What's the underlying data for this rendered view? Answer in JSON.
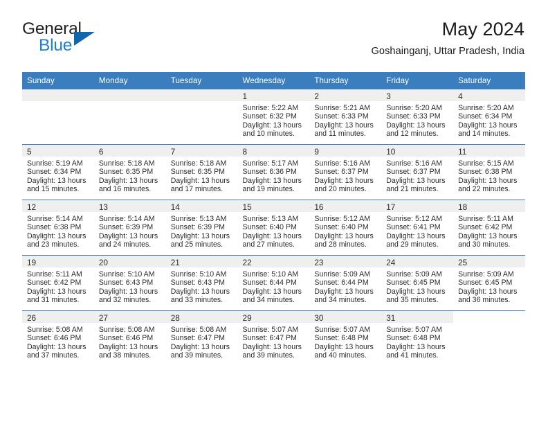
{
  "brand": {
    "word_one": "General",
    "word_two": "Blue",
    "triangle_icon": "triangle-icon"
  },
  "header": {
    "month_title": "May 2024",
    "location": "Goshainganj, Uttar Pradesh, India"
  },
  "theme": {
    "header_blue": "#3a7ec0",
    "brand_blue": "#1b7fd4",
    "band_gray": "#efefef"
  },
  "calendar": {
    "weekday_headers": [
      "Sunday",
      "Monday",
      "Tuesday",
      "Wednesday",
      "Thursday",
      "Friday",
      "Saturday"
    ],
    "weeks": [
      [
        {
          "day": "",
          "sunrise": "",
          "sunset": "",
          "daylight_1": "",
          "daylight_2": "",
          "state": "empty"
        },
        {
          "day": "",
          "sunrise": "",
          "sunset": "",
          "daylight_1": "",
          "daylight_2": "",
          "state": "empty"
        },
        {
          "day": "",
          "sunrise": "",
          "sunset": "",
          "daylight_1": "",
          "daylight_2": "",
          "state": "empty"
        },
        {
          "day": "1",
          "sunrise": "Sunrise: 5:22 AM",
          "sunset": "Sunset: 6:32 PM",
          "daylight_1": "Daylight: 13 hours",
          "daylight_2": "and 10 minutes.",
          "state": "filled"
        },
        {
          "day": "2",
          "sunrise": "Sunrise: 5:21 AM",
          "sunset": "Sunset: 6:33 PM",
          "daylight_1": "Daylight: 13 hours",
          "daylight_2": "and 11 minutes.",
          "state": "filled"
        },
        {
          "day": "3",
          "sunrise": "Sunrise: 5:20 AM",
          "sunset": "Sunset: 6:33 PM",
          "daylight_1": "Daylight: 13 hours",
          "daylight_2": "and 12 minutes.",
          "state": "filled"
        },
        {
          "day": "4",
          "sunrise": "Sunrise: 5:20 AM",
          "sunset": "Sunset: 6:34 PM",
          "daylight_1": "Daylight: 13 hours",
          "daylight_2": "and 14 minutes.",
          "state": "filled"
        }
      ],
      [
        {
          "day": "5",
          "sunrise": "Sunrise: 5:19 AM",
          "sunset": "Sunset: 6:34 PM",
          "daylight_1": "Daylight: 13 hours",
          "daylight_2": "and 15 minutes.",
          "state": "filled"
        },
        {
          "day": "6",
          "sunrise": "Sunrise: 5:18 AM",
          "sunset": "Sunset: 6:35 PM",
          "daylight_1": "Daylight: 13 hours",
          "daylight_2": "and 16 minutes.",
          "state": "filled"
        },
        {
          "day": "7",
          "sunrise": "Sunrise: 5:18 AM",
          "sunset": "Sunset: 6:35 PM",
          "daylight_1": "Daylight: 13 hours",
          "daylight_2": "and 17 minutes.",
          "state": "filled"
        },
        {
          "day": "8",
          "sunrise": "Sunrise: 5:17 AM",
          "sunset": "Sunset: 6:36 PM",
          "daylight_1": "Daylight: 13 hours",
          "daylight_2": "and 19 minutes.",
          "state": "filled"
        },
        {
          "day": "9",
          "sunrise": "Sunrise: 5:16 AM",
          "sunset": "Sunset: 6:37 PM",
          "daylight_1": "Daylight: 13 hours",
          "daylight_2": "and 20 minutes.",
          "state": "filled"
        },
        {
          "day": "10",
          "sunrise": "Sunrise: 5:16 AM",
          "sunset": "Sunset: 6:37 PM",
          "daylight_1": "Daylight: 13 hours",
          "daylight_2": "and 21 minutes.",
          "state": "filled"
        },
        {
          "day": "11",
          "sunrise": "Sunrise: 5:15 AM",
          "sunset": "Sunset: 6:38 PM",
          "daylight_1": "Daylight: 13 hours",
          "daylight_2": "and 22 minutes.",
          "state": "filled"
        }
      ],
      [
        {
          "day": "12",
          "sunrise": "Sunrise: 5:14 AM",
          "sunset": "Sunset: 6:38 PM",
          "daylight_1": "Daylight: 13 hours",
          "daylight_2": "and 23 minutes.",
          "state": "filled"
        },
        {
          "day": "13",
          "sunrise": "Sunrise: 5:14 AM",
          "sunset": "Sunset: 6:39 PM",
          "daylight_1": "Daylight: 13 hours",
          "daylight_2": "and 24 minutes.",
          "state": "filled"
        },
        {
          "day": "14",
          "sunrise": "Sunrise: 5:13 AM",
          "sunset": "Sunset: 6:39 PM",
          "daylight_1": "Daylight: 13 hours",
          "daylight_2": "and 25 minutes.",
          "state": "filled"
        },
        {
          "day": "15",
          "sunrise": "Sunrise: 5:13 AM",
          "sunset": "Sunset: 6:40 PM",
          "daylight_1": "Daylight: 13 hours",
          "daylight_2": "and 27 minutes.",
          "state": "filled"
        },
        {
          "day": "16",
          "sunrise": "Sunrise: 5:12 AM",
          "sunset": "Sunset: 6:40 PM",
          "daylight_1": "Daylight: 13 hours",
          "daylight_2": "and 28 minutes.",
          "state": "filled"
        },
        {
          "day": "17",
          "sunrise": "Sunrise: 5:12 AM",
          "sunset": "Sunset: 6:41 PM",
          "daylight_1": "Daylight: 13 hours",
          "daylight_2": "and 29 minutes.",
          "state": "filled"
        },
        {
          "day": "18",
          "sunrise": "Sunrise: 5:11 AM",
          "sunset": "Sunset: 6:42 PM",
          "daylight_1": "Daylight: 13 hours",
          "daylight_2": "and 30 minutes.",
          "state": "filled"
        }
      ],
      [
        {
          "day": "19",
          "sunrise": "Sunrise: 5:11 AM",
          "sunset": "Sunset: 6:42 PM",
          "daylight_1": "Daylight: 13 hours",
          "daylight_2": "and 31 minutes.",
          "state": "filled"
        },
        {
          "day": "20",
          "sunrise": "Sunrise: 5:10 AM",
          "sunset": "Sunset: 6:43 PM",
          "daylight_1": "Daylight: 13 hours",
          "daylight_2": "and 32 minutes.",
          "state": "filled"
        },
        {
          "day": "21",
          "sunrise": "Sunrise: 5:10 AM",
          "sunset": "Sunset: 6:43 PM",
          "daylight_1": "Daylight: 13 hours",
          "daylight_2": "and 33 minutes.",
          "state": "filled"
        },
        {
          "day": "22",
          "sunrise": "Sunrise: 5:10 AM",
          "sunset": "Sunset: 6:44 PM",
          "daylight_1": "Daylight: 13 hours",
          "daylight_2": "and 34 minutes.",
          "state": "filled"
        },
        {
          "day": "23",
          "sunrise": "Sunrise: 5:09 AM",
          "sunset": "Sunset: 6:44 PM",
          "daylight_1": "Daylight: 13 hours",
          "daylight_2": "and 34 minutes.",
          "state": "filled"
        },
        {
          "day": "24",
          "sunrise": "Sunrise: 5:09 AM",
          "sunset": "Sunset: 6:45 PM",
          "daylight_1": "Daylight: 13 hours",
          "daylight_2": "and 35 minutes.",
          "state": "filled"
        },
        {
          "day": "25",
          "sunrise": "Sunrise: 5:09 AM",
          "sunset": "Sunset: 6:45 PM",
          "daylight_1": "Daylight: 13 hours",
          "daylight_2": "and 36 minutes.",
          "state": "filled"
        }
      ],
      [
        {
          "day": "26",
          "sunrise": "Sunrise: 5:08 AM",
          "sunset": "Sunset: 6:46 PM",
          "daylight_1": "Daylight: 13 hours",
          "daylight_2": "and 37 minutes.",
          "state": "filled"
        },
        {
          "day": "27",
          "sunrise": "Sunrise: 5:08 AM",
          "sunset": "Sunset: 6:46 PM",
          "daylight_1": "Daylight: 13 hours",
          "daylight_2": "and 38 minutes.",
          "state": "filled"
        },
        {
          "day": "28",
          "sunrise": "Sunrise: 5:08 AM",
          "sunset": "Sunset: 6:47 PM",
          "daylight_1": "Daylight: 13 hours",
          "daylight_2": "and 39 minutes.",
          "state": "filled"
        },
        {
          "day": "29",
          "sunrise": "Sunrise: 5:07 AM",
          "sunset": "Sunset: 6:47 PM",
          "daylight_1": "Daylight: 13 hours",
          "daylight_2": "and 39 minutes.",
          "state": "filled"
        },
        {
          "day": "30",
          "sunrise": "Sunrise: 5:07 AM",
          "sunset": "Sunset: 6:48 PM",
          "daylight_1": "Daylight: 13 hours",
          "daylight_2": "and 40 minutes.",
          "state": "filled"
        },
        {
          "day": "31",
          "sunrise": "Sunrise: 5:07 AM",
          "sunset": "Sunset: 6:48 PM",
          "daylight_1": "Daylight: 13 hours",
          "daylight_2": "and 41 minutes.",
          "state": "filled"
        },
        {
          "day": "",
          "sunrise": "",
          "sunset": "",
          "daylight_1": "",
          "daylight_2": "",
          "state": "blank"
        }
      ]
    ]
  }
}
